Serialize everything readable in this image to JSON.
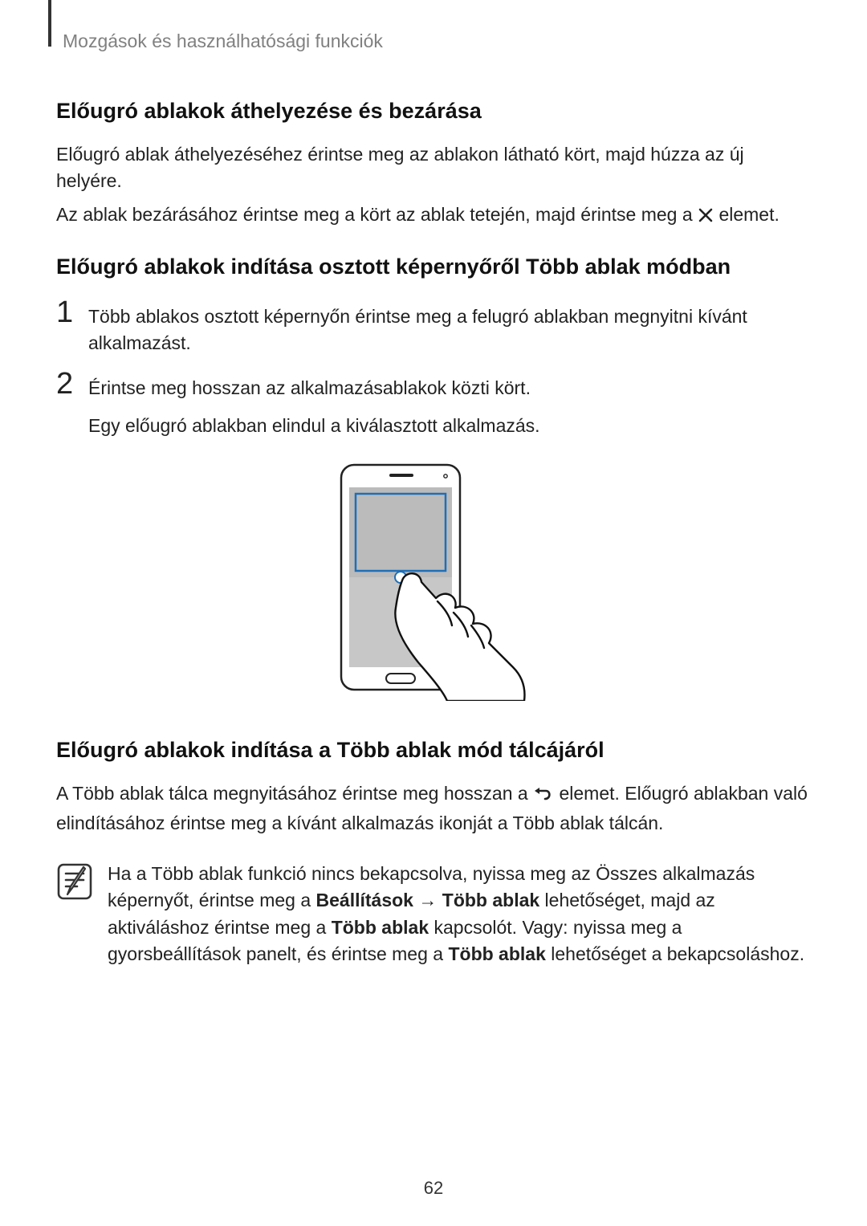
{
  "header": "Mozgások és használhatósági funkciók",
  "h1": "Előugró ablakok áthelyezése és bezárása",
  "p1": "Előugró ablak áthelyezéséhez érintse meg az ablakon látható kört, majd húzza az új helyére.",
  "p2a": "Az ablak bezárásához érintse meg a kört az ablak tetején, majd érintse meg a ",
  "p2b": " elemet.",
  "h2": "Előugró ablakok indítása osztott képernyőről Több ablak módban",
  "step1_num": "1",
  "step1": "Több ablakos osztott képernyőn érintse meg a felugró ablakban megnyitni kívánt alkalmazást.",
  "step2_num": "2",
  "step2": "Érintse meg hosszan az alkalmazásablakok közti kört.",
  "step2_sub": "Egy előugró ablakban elindul a kiválasztott alkalmazás.",
  "h3": "Előugró ablakok indítása a Több ablak mód tálcájáról",
  "p3a": "A Több ablak tálca megnyitásához érintse meg hosszan a ",
  "p3b": " elemet. Előugró ablakban való elindításához érintse meg a kívánt alkalmazás ikonját a Több ablak tálcán.",
  "note_a": "Ha a Több ablak funkció nincs bekapcsolva, nyissa meg az Összes alkalmazás képernyőt, érintse meg a ",
  "note_b1": "Beállítások",
  "note_arrow": " → ",
  "note_b2": "Több ablak",
  "note_c": " lehetőséget, majd az aktiváláshoz érintse meg a ",
  "note_b3": "Több ablak",
  "note_d": " kapcsolót. Vagy: nyissa meg a gyorsbeállítások panelt, és érintse meg a ",
  "note_b4": "Több ablak",
  "note_e": " lehetőséget a bekapcsoláshoz.",
  "page_number": "62"
}
